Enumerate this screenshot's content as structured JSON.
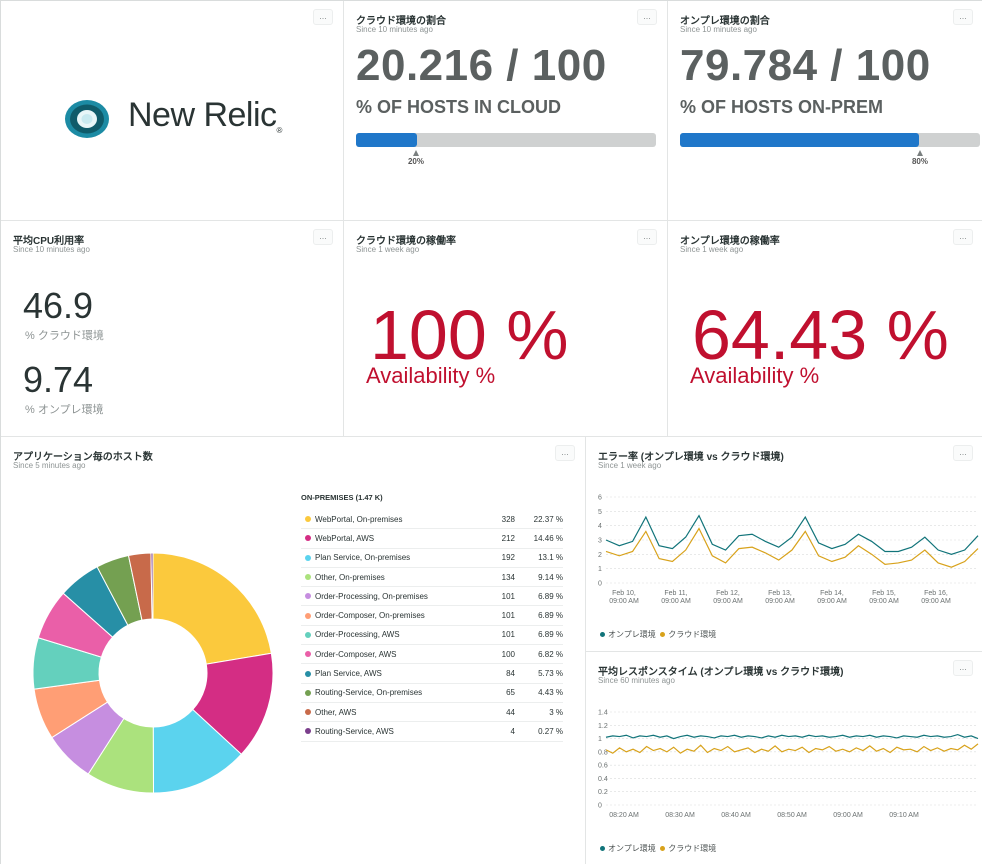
{
  "logo": {
    "name": "New Relic",
    "reg": "®"
  },
  "more_label": "...",
  "cloud_share": {
    "title": "クラウド環境の割合",
    "since": "Since 10 minutes ago",
    "fraction": "20.216 / 100",
    "label": "% OF HOSTS IN CLOUD",
    "progress_fraction": 0.20216,
    "tick_label": "20%",
    "tick_fraction": 0.2
  },
  "onprem_share": {
    "title": "オンプレ環境の割合",
    "since": "Since 10 minutes ago",
    "fraction": "79.784 / 100",
    "label": "% OF HOSTS ON-PREM",
    "progress_fraction": 0.79784,
    "tick_label": "80%",
    "tick_fraction": 0.8
  },
  "cpu": {
    "title": "平均CPU利用率",
    "since": "Since 10 minutes ago",
    "cloud_value": "46.9",
    "cloud_label": "% クラウド環境",
    "onprem_value": "9.74",
    "onprem_label": "% オンプレ環境"
  },
  "cloud_avail": {
    "title": "クラウド環境の稼働率",
    "since": "Since 1 week ago",
    "value": "100 %",
    "label": "Availability %"
  },
  "onprem_avail": {
    "title": "オンプレ環境の稼働率",
    "since": "Since 1 week ago",
    "value": "64.43 %",
    "label": "Availability %"
  },
  "hosts": {
    "title": "アプリケーション毎のホスト数",
    "since": "Since 5 minutes ago",
    "legend_title": "ON-PREMISES (1.47 K)",
    "rows": [
      {
        "name": "WebPortal, On-premises",
        "value": "328",
        "pct": "22.37 %"
      },
      {
        "name": "WebPortal, AWS",
        "value": "212",
        "pct": "14.46 %"
      },
      {
        "name": "Plan Service, On-premises",
        "value": "192",
        "pct": "13.1 %"
      },
      {
        "name": "Other, On-premises",
        "value": "134",
        "pct": "9.14 %"
      },
      {
        "name": "Order-Processing, On-premises",
        "value": "101",
        "pct": "6.89 %"
      },
      {
        "name": "Order-Composer, On-premises",
        "value": "101",
        "pct": "6.89 %"
      },
      {
        "name": "Order-Processing, AWS",
        "value": "101",
        "pct": "6.89 %"
      },
      {
        "name": "Order-Composer, AWS",
        "value": "100",
        "pct": "6.82 %"
      },
      {
        "name": "Plan Service, AWS",
        "value": "84",
        "pct": "5.73 %"
      },
      {
        "name": "Routing-Service, On-premises",
        "value": "65",
        "pct": "4.43 %"
      },
      {
        "name": "Other, AWS",
        "value": "44",
        "pct": "3 %"
      },
      {
        "name": "Routing-Service, AWS",
        "value": "4",
        "pct": "0.27 %"
      }
    ]
  },
  "error_chart": {
    "title": "エラー率 (オンプレ環境 vs クラウド環境)",
    "since": "Since 1 week ago",
    "legend_a": "オンプレ環境",
    "legend_b": "クラウド環境"
  },
  "resp_chart": {
    "title": "平均レスポンスタイム (オンプレ環境 vs クラウド環境)",
    "since": "Since 60 minutes ago",
    "legend_a": "オンプレ環境",
    "legend_b": "クラウド環境"
  },
  "chart_data": [
    {
      "type": "pie",
      "categories": [
        "WebPortal, On-premises",
        "WebPortal, AWS",
        "Plan Service, On-premises",
        "Other, On-premises",
        "Order-Processing, On-premises",
        "Order-Composer, On-premises",
        "Order-Processing, AWS",
        "Order-Composer, AWS",
        "Plan Service, AWS",
        "Routing-Service, On-premises",
        "Other, AWS",
        "Routing-Service, AWS"
      ],
      "values": [
        328,
        212,
        192,
        134,
        101,
        101,
        101,
        100,
        84,
        65,
        44,
        4
      ],
      "colors": [
        "#fbc93d",
        "#d42d84",
        "#5bd3ee",
        "#abe27d",
        "#c68ee0",
        "#ff9e75",
        "#64d0bd",
        "#ea5fa8",
        "#278fa6",
        "#74a051",
        "#c86a4a",
        "#7b3f8c"
      ],
      "title": "アプリケーション毎のホスト数"
    },
    {
      "type": "line",
      "title": "エラー率 (オンプレ環境 vs クラウド環境)",
      "x": [
        "Feb 10, 09:00 AM",
        "Feb 11, 09:00 AM",
        "Feb 12, 09:00 AM",
        "Feb 13, 09:00 AM",
        "Feb 14, 09:00 AM",
        "Feb 15, 09:00 AM",
        "Feb 16, 09:00 AM"
      ],
      "ylim": [
        0,
        6
      ],
      "yticks": [
        0,
        1,
        2,
        3,
        4,
        5,
        6
      ],
      "grid": true,
      "legend": "bottom",
      "series": [
        {
          "name": "オンプレ環境",
          "color": "#11747a",
          "values": [
            3.0,
            2.6,
            2.9,
            4.6,
            2.6,
            2.4,
            3.2,
            4.7,
            2.7,
            2.3,
            3.3,
            3.4,
            2.9,
            2.5,
            3.2,
            4.6,
            2.8,
            2.4,
            2.7,
            3.4,
            2.9,
            2.2,
            2.2,
            2.5,
            3.2,
            2.3,
            2.0,
            2.3,
            3.3
          ]
        },
        {
          "name": "クラウド環境",
          "color": "#d8a21b",
          "values": [
            2.2,
            1.9,
            2.2,
            3.6,
            1.7,
            1.5,
            2.3,
            3.8,
            1.9,
            1.4,
            2.4,
            2.5,
            2.1,
            1.6,
            2.3,
            3.6,
            1.9,
            1.5,
            1.8,
            2.6,
            2.0,
            1.3,
            1.4,
            1.6,
            2.3,
            1.4,
            1.1,
            1.5,
            2.4
          ]
        }
      ]
    },
    {
      "type": "line",
      "title": "平均レスポンスタイム (オンプレ環境 vs クラウド環境)",
      "x": [
        "08:20 AM",
        "08:30 AM",
        "08:40 AM",
        "08:50 AM",
        "09:00 AM",
        "09:10 AM"
      ],
      "ylim": [
        0,
        1.4
      ],
      "yticks": [
        0,
        0.2,
        0.4,
        0.6,
        0.8,
        1,
        1.2,
        1.4
      ],
      "grid": true,
      "legend": "bottom",
      "series": [
        {
          "name": "オンプレ環境",
          "color": "#11747a",
          "values": [
            1.02,
            1.04,
            1.03,
            1.05,
            1.01,
            1.04,
            1.03,
            1.05,
            1.02,
            1.04,
            1.0,
            1.03,
            1.05,
            1.02,
            1.04,
            1.03,
            1.01,
            1.04,
            1.03,
            1.05,
            1.02,
            1.04,
            1.03,
            1.01,
            1.04,
            1.02,
            1.05,
            1.03,
            1.04,
            1.02,
            1.05,
            1.03,
            1.04,
            1.02,
            1.03,
            1.05,
            1.02,
            1.04,
            1.03,
            1.05,
            1.02,
            1.04,
            1.03,
            1.01,
            1.04,
            1.03,
            1.02,
            1.05,
            1.03,
            1.04,
            1.02,
            1.03,
            1.06,
            1.02,
            1.04,
            1.0
          ]
        },
        {
          "name": "クラウド環境",
          "color": "#d8a21b",
          "values": [
            0.83,
            0.78,
            0.86,
            0.8,
            0.84,
            0.79,
            0.88,
            0.82,
            0.85,
            0.8,
            0.87,
            0.78,
            0.84,
            0.81,
            0.9,
            0.79,
            0.85,
            0.82,
            0.88,
            0.8,
            0.83,
            0.86,
            0.79,
            0.84,
            0.81,
            0.89,
            0.8,
            0.84,
            0.82,
            0.87,
            0.79,
            0.85,
            0.83,
            0.88,
            0.81,
            0.84,
            0.8,
            0.86,
            0.82,
            0.89,
            0.81,
            0.85,
            0.79,
            0.87,
            0.83,
            0.84,
            0.8,
            0.88,
            0.82,
            0.86,
            0.81,
            0.85,
            0.83,
            0.9,
            0.84,
            0.92
          ]
        }
      ]
    }
  ]
}
